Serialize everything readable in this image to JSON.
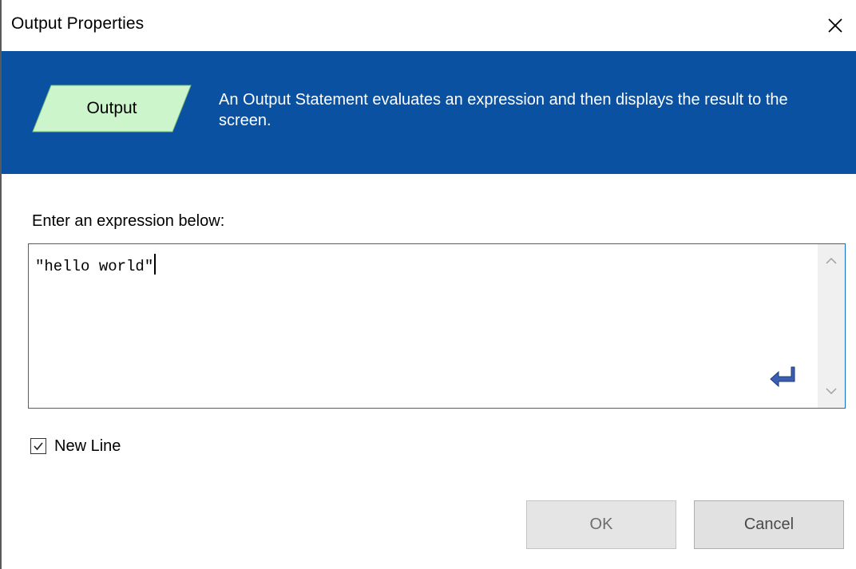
{
  "window": {
    "title": "Output Properties"
  },
  "banner": {
    "shape_label": "Output",
    "description": "An Output Statement evaluates an expression and then displays the result to the screen.",
    "background_color": "#0a51a1",
    "shape_color": "#ccf5cc"
  },
  "expression": {
    "label": "Enter an expression below:",
    "value": "\"hello world\""
  },
  "options": {
    "new_line_label": "New Line",
    "new_line_checked": true
  },
  "buttons": {
    "ok_label": "OK",
    "cancel_label": "Cancel"
  },
  "icons": {
    "close": "close-icon",
    "enter": "enter-icon",
    "scroll_up": "chevron-up-icon",
    "scroll_down": "chevron-down-icon",
    "check": "checkmark-icon"
  }
}
